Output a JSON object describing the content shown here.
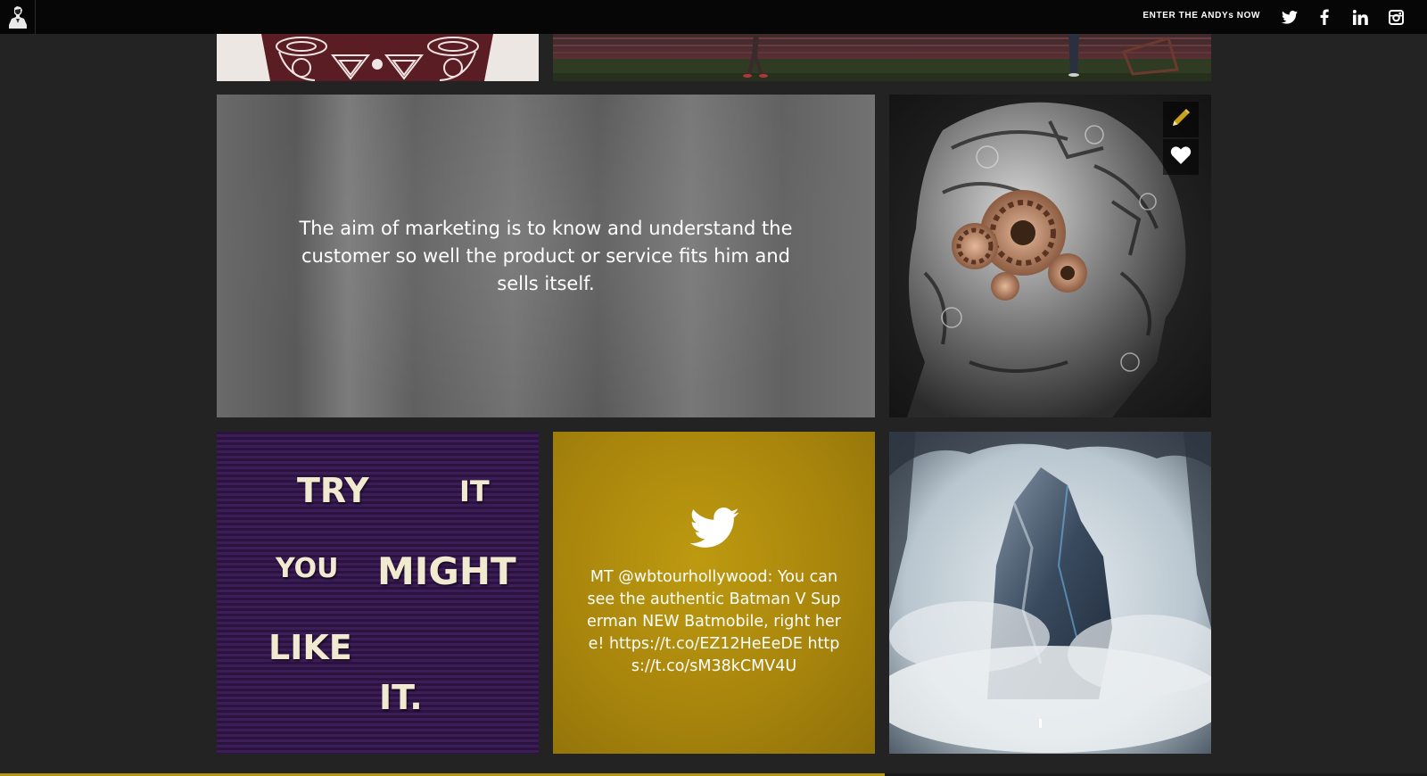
{
  "header": {
    "logo_icon": "andy-portrait-icon",
    "enter_link": "ENTER THE ANDYs NOW",
    "social": [
      "twitter-icon",
      "facebook-icon",
      "linkedin-icon",
      "instagram-icon"
    ]
  },
  "quote_tile": {
    "text": "The aim of marketing is to know and understand the customer so well the product or service fits him and sells itself."
  },
  "letterboard_tile": {
    "words": [
      "TRY",
      "IT",
      "YOU",
      "MIGHT",
      "LIKE",
      "IT."
    ]
  },
  "tweet_tile": {
    "icon": "twitter-bird-icon",
    "text": "MT @wbtourhollywood: You can see the authentic Batman V Superman NEW Batmobile, right here! https://t.co/EZ12HeEeDE https://t.co/sM38kCMV4U"
  },
  "overlay": {
    "edit_icon": "pencil-icon",
    "like_icon": "heart-icon"
  },
  "colors": {
    "background": "#232323",
    "topbar": "#060606",
    "accent_gold": "#b8940f"
  },
  "progress": {
    "fraction": 0.62
  }
}
